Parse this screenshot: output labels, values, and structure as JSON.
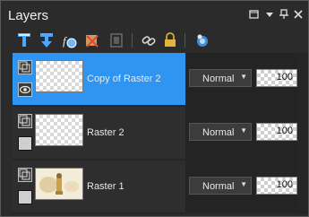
{
  "panel": {
    "title": "Layers",
    "window_buttons": [
      "menu-icon",
      "float-icon",
      "pin-icon",
      "close-icon"
    ]
  },
  "toolbar": {
    "tools": [
      "new-raster-layer-icon",
      "new-vector-layer-icon",
      "new-adjustment-layer-icon",
      "delete-layer-icon",
      "merge-icon",
      "link-icon",
      "lock-icon",
      "visibility-icon"
    ]
  },
  "layers": [
    {
      "name": "Copy of Raster 2",
      "blend": "Normal",
      "opacity": "100",
      "selected": true,
      "visible": true
    },
    {
      "name": "Raster 2",
      "blend": "Normal",
      "opacity": "100",
      "selected": false,
      "visible": false
    },
    {
      "name": "Raster 1",
      "blend": "Normal",
      "opacity": "100",
      "selected": false,
      "visible": false
    }
  ],
  "colors": {
    "selection": "#2f95f2",
    "panel": "#2b2b2b",
    "accent_tool": "#4aa8ff"
  }
}
